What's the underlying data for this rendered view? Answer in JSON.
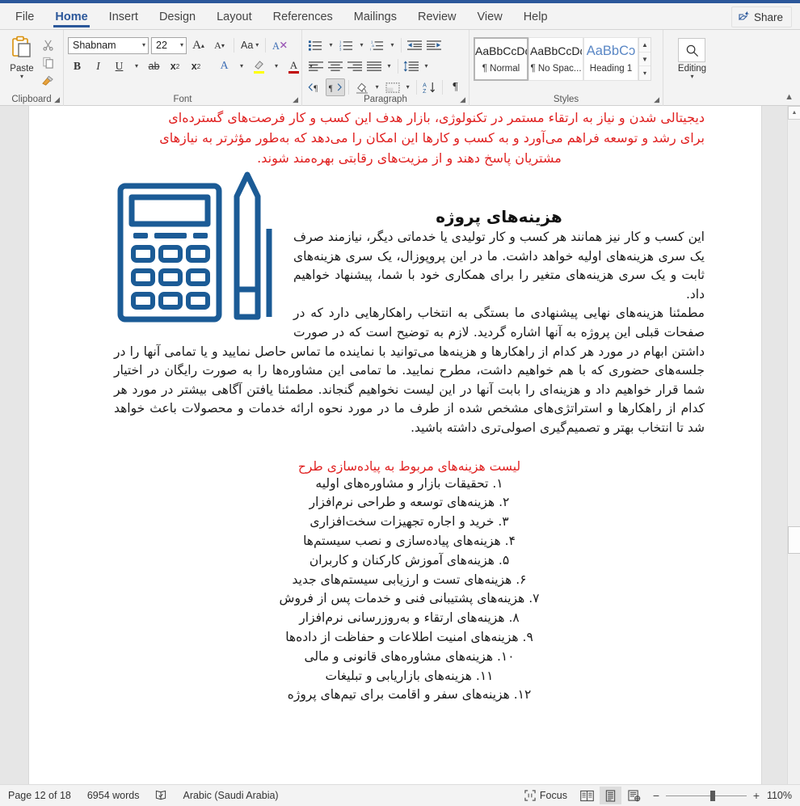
{
  "window": {
    "share_label": "Share"
  },
  "tabs": [
    {
      "label": "File",
      "active": false
    },
    {
      "label": "Home",
      "active": true
    },
    {
      "label": "Insert",
      "active": false
    },
    {
      "label": "Design",
      "active": false
    },
    {
      "label": "Layout",
      "active": false
    },
    {
      "label": "References",
      "active": false
    },
    {
      "label": "Mailings",
      "active": false
    },
    {
      "label": "Review",
      "active": false
    },
    {
      "label": "View",
      "active": false
    },
    {
      "label": "Help",
      "active": false
    }
  ],
  "ribbon": {
    "clipboard": {
      "group_label": "Clipboard",
      "paste_label": "Paste",
      "cut_icon": "scissors-icon",
      "copy_icon": "copy-icon",
      "format_painter_icon": "format-painter-icon"
    },
    "font": {
      "group_label": "Font",
      "font_name": "Shabnam",
      "font_size": "22",
      "grow_font": "A",
      "shrink_font": "A",
      "change_case": "Aa",
      "clear_formatting_icon": "clear-formatting-icon",
      "bold": "B",
      "italic": "I",
      "underline": "U",
      "strikethrough": "ab",
      "subscript": "x",
      "superscript": "x",
      "text_effects": "A",
      "highlight": "A",
      "font_color": "A",
      "font_color_hex": "#c00000",
      "highlight_hex": "#ffff00"
    },
    "paragraph": {
      "group_label": "Paragraph",
      "bullets_icon": "bullet-list-icon",
      "numbering_icon": "numbered-list-icon",
      "multilevel_icon": "multilevel-list-icon",
      "decrease_indent_icon": "decrease-indent-icon",
      "increase_indent_icon": "increase-indent-icon",
      "align_left_icon": "align-left-icon",
      "align_center_icon": "align-center-icon",
      "align_right_icon": "align-right-icon",
      "justify_icon": "justify-icon",
      "line_spacing_icon": "line-spacing-icon",
      "ltr_label": "¶",
      "rtl_label": "¶",
      "shading_icon": "shading-icon",
      "borders_icon": "borders-icon",
      "sort_icon": "sort-icon",
      "show_marks": "¶"
    },
    "styles": {
      "group_label": "Styles",
      "items": [
        {
          "sample": "AaBbCcDc",
          "name": "¶ Normal",
          "selected": true
        },
        {
          "sample": "AaBbCcDc",
          "name": "¶ No Spac...",
          "selected": false
        },
        {
          "sample": "AaBbCɔ",
          "name": "Heading 1",
          "selected": false
        }
      ]
    },
    "editing": {
      "group_label": "",
      "label": "Editing",
      "icon": "search-icon"
    },
    "collapse_icon": "chevron-up-icon"
  },
  "document": {
    "red_intro_lines": [
      "دیجیتالی شدن و نیاز به ارتقاء مستمر در تکنولوژی، بازار هدف این کسب و کار فرصت‌های گسترده‌ای",
      "برای رشد و توسعه فراهم می‌آورد و به کسب و کارها این امکان را می‌دهد که به‌طور مؤثرتر به نیازهای",
      "مشتریان پاسخ دهند و از مزیت‌های رقابتی بهره‌مند شوند."
    ],
    "heading": "هزینه‌های پروژه",
    "paragraph_1": "این کسب و کار نیز همانند هر کسب و کار تولیدی یا خدماتی دیگر، نیازمند صرف یک سری هزینه‌های اولیه خواهد داشت. ما در این پروپوزال، یک سری هزینه‌های ثابت و یک سری هزینه‌های متغیر را برای همکاری خود با شما، پیشنهاد خواهیم داد.",
    "paragraph_2": "مطمئنا هزینه‌های نهایی پیشنهادی ما بستگی به انتخاب راهکارهایی دارد که در صفحات قبلی این پروژه به آنها اشاره گردید. لازم به توضیح است که در صورت داشتن ابهام در مورد هر کدام از راهکارها و هزینه‌ها می‌توانید با نماینده ما تماس حاصل نمایید و یا تمامی آنها را در جلسه‌های حضوری که با هم خواهیم داشت، مطرح نمایید. ما تمامی این مشاوره‌ها را به صورت رایگان در اختیار شما قرار خواهیم داد و هزینه‌ای را بابت آنها در این لیست نخواهیم گنجاند. مطمئنا یافتن آگاهی بیشتر در مورد هر کدام از راهکارها و استراتژی‌های مشخص شده از طرف ما در مورد نحوه ارائه خدمات و محصولات باعث خواهد شد تا انتخاب بهتر و تصمیم‌گیری اصولی‌تری داشته باشید.",
    "list_heading": "لیست هزینه‌های مربوط به پیاده‌سازی طرح",
    "list_items": [
      "۱. تحقیقات بازار و مشاوره‌های اولیه",
      "۲. هزینه‌های توسعه و طراحی نرم‌افزار",
      "۳. خرید و اجاره تجهیزات سخت‌افزاری",
      "۴. هزینه‌های پیاده‌سازی و نصب سیستم‌ها",
      "۵. هزینه‌های آموزش کارکنان و کاربران",
      "۶. هزینه‌های تست و ارزیابی سیستم‌های جدید",
      "۷. هزینه‌های پشتیبانی فنی و خدمات پس از فروش",
      "۸. هزینه‌های ارتقاء و به‌روزرسانی نرم‌افزار",
      "۹. هزینه‌های امنیت اطلاعات و حفاظت از داده‌ها",
      "۱۰. هزینه‌های مشاوره‌های قانونی و مالی",
      "۱۱. هزینه‌های بازاریابی و تبلیغات",
      "۱۲. هزینه‌های سفر و اقامت برای تیم‌های پروژه"
    ],
    "image": {
      "name": "calculator-and-pencil-illustration",
      "color": "#1b5b96"
    },
    "text_color_red": "#e02020"
  },
  "statusbar": {
    "page": "Page 12 of 18",
    "words": "6954 words",
    "proofing_icon": "proofing-errors-icon",
    "language": "Arabic (Saudi Arabia)",
    "focus": "Focus",
    "focus_icon": "focus-mode-icon",
    "view_read_icon": "read-mode-icon",
    "view_print_icon": "print-layout-icon",
    "view_web_icon": "web-layout-icon",
    "zoom_out": "−",
    "zoom_in": "+",
    "zoom_level": "110%"
  }
}
